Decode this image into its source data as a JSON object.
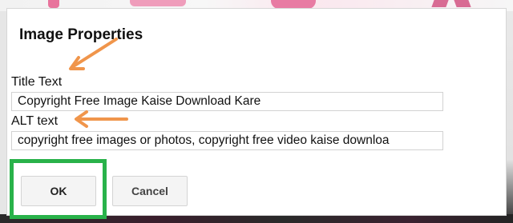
{
  "dialog": {
    "title": "Image Properties",
    "title_text_label": "Title Text",
    "title_text_value": "Copyright Free Image Kaise Download Kare",
    "alt_text_label": "ALT text",
    "alt_text_value": "copyright free images or photos, copyright free video kaise downloa",
    "ok_label": "OK",
    "cancel_label": "Cancel"
  },
  "annotations": {
    "arrow_icon": "arrow-icon",
    "arrow_color": "#f0954b",
    "highlight_color": "#29b24a"
  }
}
